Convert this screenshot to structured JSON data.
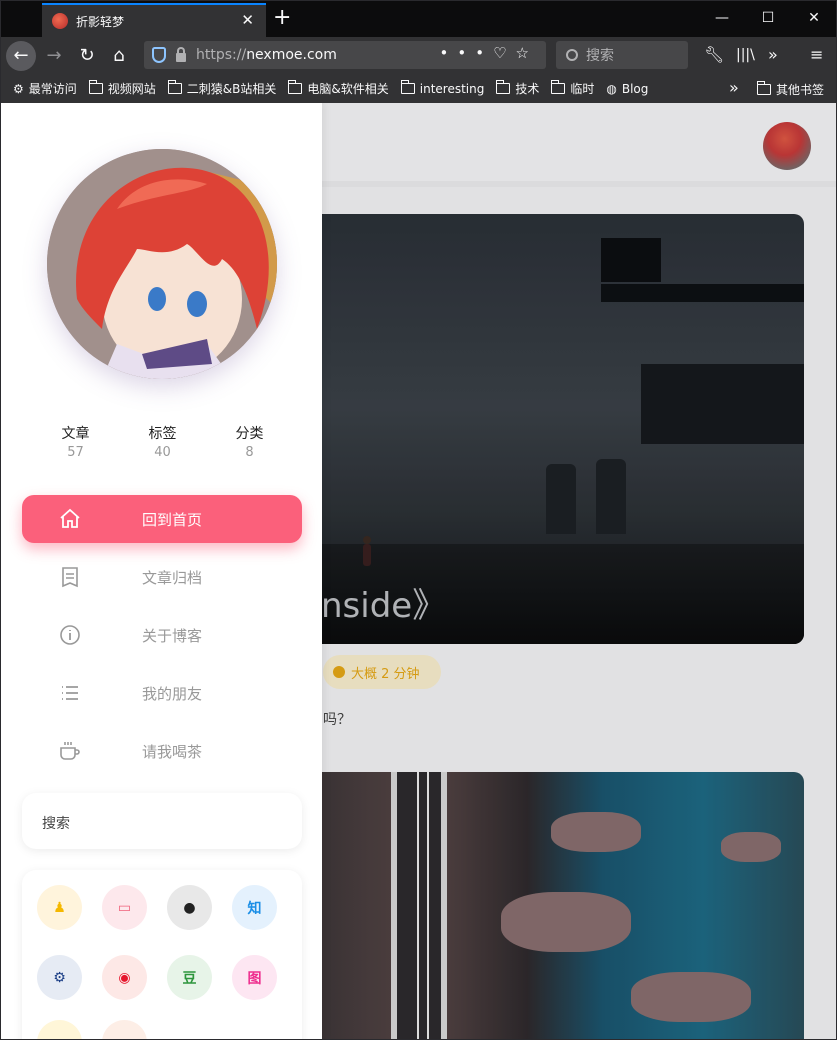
{
  "browser": {
    "tab_title": "折影轻梦",
    "url_protocol": "https://",
    "url_host": "nexmoe.com",
    "search_placeholder": "搜索",
    "bookmarks": [
      "最常访问",
      "视频网站",
      "二刺猿&B站相关",
      "电脑&软件相关",
      "interesting",
      "技术",
      "临时",
      "Blog"
    ],
    "other_bookmarks": "其他书签"
  },
  "sidebar": {
    "stats": [
      {
        "label": "文章",
        "value": "57"
      },
      {
        "label": "标签",
        "value": "40"
      },
      {
        "label": "分类",
        "value": "8"
      }
    ],
    "menu": [
      {
        "label": "回到首页",
        "icon": "home-icon",
        "active": true
      },
      {
        "label": "文章归档",
        "icon": "archive-icon",
        "active": false
      },
      {
        "label": "关于博客",
        "icon": "info-icon",
        "active": false
      },
      {
        "label": "我的朋友",
        "icon": "list-icon",
        "active": false
      },
      {
        "label": "请我喝茶",
        "icon": "coffee-icon",
        "active": false
      }
    ],
    "search_placeholder": "搜索",
    "social": [
      {
        "icon": "qq-icon",
        "bg": "#fff4dc",
        "fg": "#f5b800"
      },
      {
        "icon": "bilibili-icon",
        "bg": "#fde8ec",
        "fg": "#f0607a",
        "glyph": "▭"
      },
      {
        "icon": "github-icon",
        "bg": "#e8e8e8",
        "fg": "#222"
      },
      {
        "icon": "zhihu-icon",
        "bg": "#e4f1fd",
        "fg": "#1a8ee6",
        "glyph": "知"
      },
      {
        "icon": "steam-icon",
        "bg": "#e6ebf4",
        "fg": "#1b3e86"
      },
      {
        "icon": "weibo-icon",
        "bg": "#fde8e6",
        "fg": "#e6162d"
      },
      {
        "icon": "douban-icon",
        "bg": "#e7f4e8",
        "fg": "#2e963d",
        "glyph": "豆"
      },
      {
        "icon": "pixiv-icon",
        "bg": "#fde6f2",
        "fg": "#ee2f8f",
        "glyph": "图"
      }
    ]
  },
  "main": {
    "post_title": "nside》",
    "read_time": "大概 2 分钟",
    "excerpt": "吗？"
  },
  "colors": {
    "accent": "#fb607b",
    "browser_dark": "#323234"
  }
}
